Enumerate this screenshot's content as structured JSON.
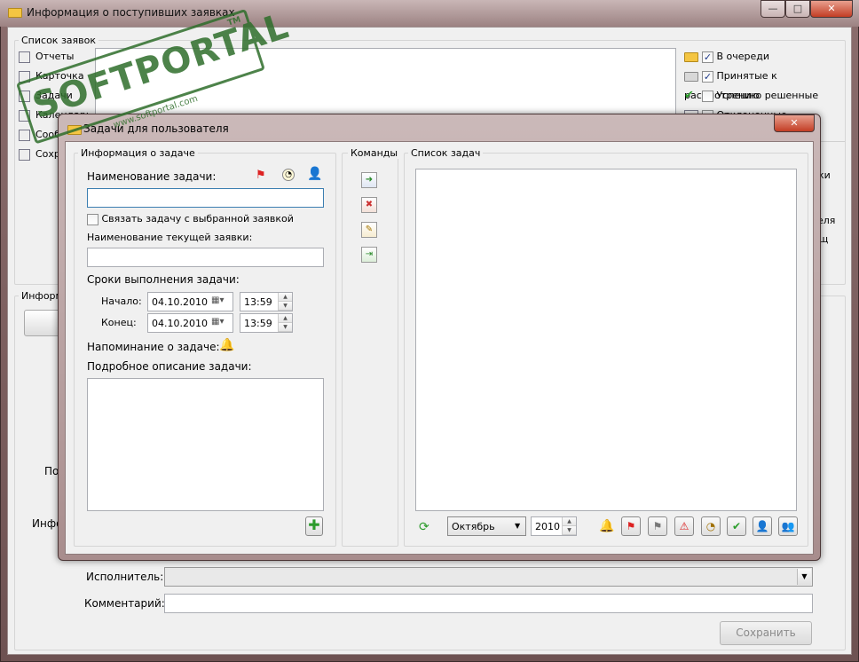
{
  "main_window": {
    "title": "Информация о поступивших заявках",
    "caption_buttons": {
      "minimize": "—",
      "maximize": "□",
      "close": "✕"
    }
  },
  "requests_group": {
    "title": "Список заявок",
    "nav_items": [
      {
        "label": "Отчеты",
        "icon": "report-icon"
      },
      {
        "label": "Карточка",
        "icon": "card-icon"
      },
      {
        "label": "Задачи",
        "icon": "tasks-icon"
      },
      {
        "label": "Календарь",
        "icon": "calendar-icon"
      },
      {
        "label": "Сообщения",
        "icon": "message-icon"
      },
      {
        "label": "Сохранить",
        "icon": "save-icon"
      }
    ],
    "filters": [
      {
        "label": "В очереди",
        "checked": true,
        "icon": "envelope-icon"
      },
      {
        "label": "Принятые к рассмотрению",
        "checked": true,
        "icon": "envelope-open-icon"
      },
      {
        "label": "Успешно решенные",
        "checked": false,
        "icon": "checkmark-icon"
      },
      {
        "label": "Отклоненные",
        "checked": false,
        "icon": "clipboard-icon"
      }
    ],
    "side_fragments": [
      "ки",
      "еля",
      "щ"
    ]
  },
  "info_group": {
    "title": "Информация",
    "label_fragment_1": "По",
    "label_fragment_2": "Инфо"
  },
  "bottom_form": {
    "executor_label": "Исполнитель:",
    "comment_label": "Комментарий:",
    "save_button": "Сохранить"
  },
  "dialog": {
    "title": "Задачи для пользователя",
    "task_info": {
      "group_title": "Информация о задаче",
      "name_label": "Наименование задачи:",
      "name_value": "",
      "link_checkbox_label": "Связать задачу с выбранной заявкой",
      "link_checked": false,
      "current_request_label": "Наименование текущей заявки:",
      "current_request_value": "",
      "terms_label": "Сроки выполнения задачи:",
      "start_label": "Начало:",
      "start_date": "04.10.2010",
      "start_time": "13:59",
      "end_label": "Конец:",
      "end_date": "04.10.2010",
      "end_time": "13:59",
      "reminder_label": "Напоминание о задаче:",
      "description_label": "Подробное описание задачи:",
      "description_value": ""
    },
    "commands": {
      "group_title": "Команды"
    },
    "task_list": {
      "group_title": "Список задач",
      "month": "Октябрь",
      "year": "2010"
    }
  },
  "watermark": {
    "text": "SOFTPORTAL",
    "url": "www.softportal.com",
    "tm": "TM"
  }
}
